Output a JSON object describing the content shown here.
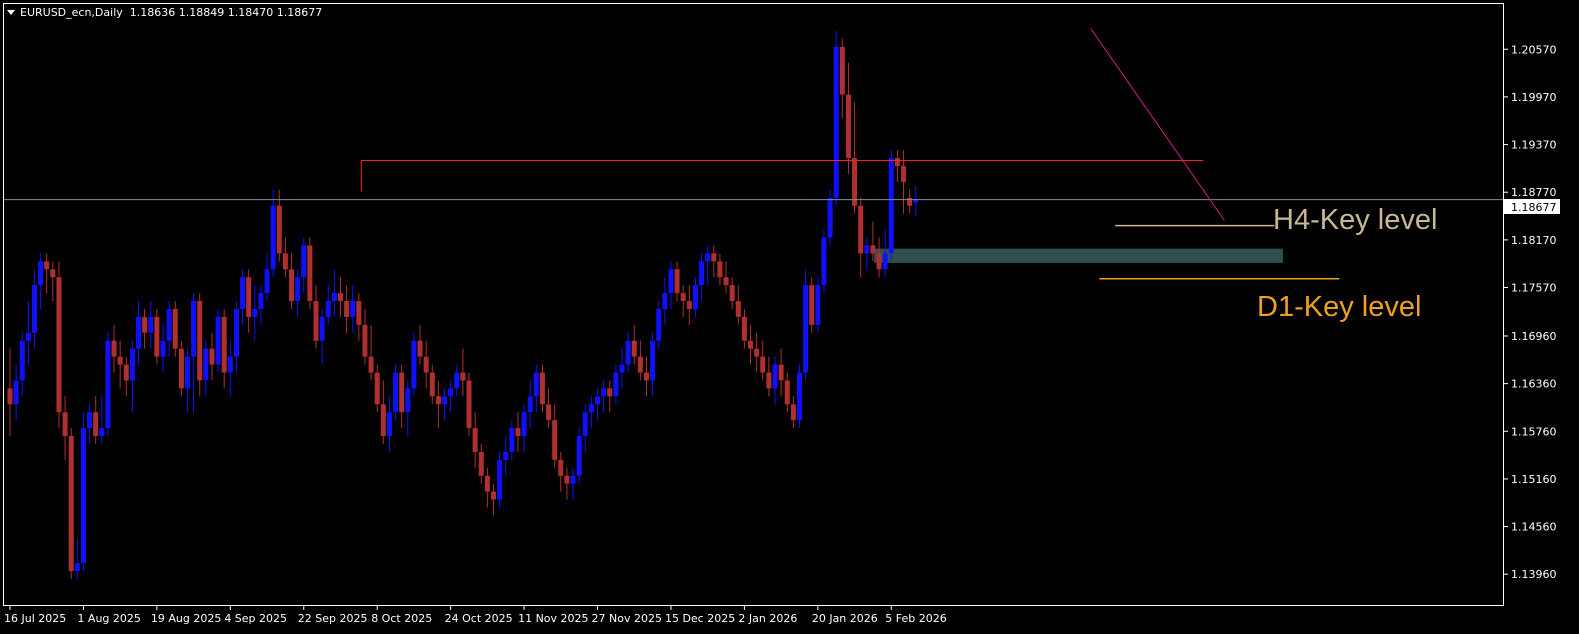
{
  "header": {
    "symbol": "EURUSD_ecn,Daily",
    "ohlc": "1.18636 1.18849 1.18470 1.18677"
  },
  "colors": {
    "background": "#000000",
    "frame": "#ffffff",
    "bull": "#1010ff",
    "bear": "#b03030",
    "bid_line": "#7f8fa6",
    "resistance_line": "#ff2020",
    "trend_line": "#d0208a",
    "h4_level": "#c8b994",
    "d1_level": "#f0a020",
    "zone": "#2f4f4f"
  },
  "chart_data": {
    "type": "candlestick",
    "xlabels": [
      "16 Jul 2025",
      "1 Aug 2025",
      "19 Aug 2025",
      "4 Sep 2025",
      "22 Sep 2025",
      "8 Oct 2025",
      "24 Oct 2025",
      "11 Nov 2025",
      "27 Nov 2025",
      "15 Dec 2025",
      "2 Jan 2026",
      "20 Jan 2026",
      "5 Feb 2026"
    ],
    "yticks": [
      "1.20570",
      "1.19970",
      "1.19370",
      "1.18770",
      "1.18170",
      "1.17570",
      "1.16960",
      "1.16360",
      "1.15760",
      "1.15160",
      "1.14560",
      "1.13960"
    ],
    "ylim": [
      1.1356,
      1.2114
    ],
    "current_price": "1.18677",
    "candles": [
      [
        1.163,
        1.168,
        1.157,
        1.161
      ],
      [
        1.161,
        1.166,
        1.159,
        1.164
      ],
      [
        1.164,
        1.17,
        1.162,
        1.169
      ],
      [
        1.169,
        1.174,
        1.166,
        1.17
      ],
      [
        1.17,
        1.178,
        1.168,
        1.176
      ],
      [
        1.176,
        1.18,
        1.173,
        1.179
      ],
      [
        1.179,
        1.18,
        1.175,
        1.178
      ],
      [
        1.178,
        1.179,
        1.174,
        1.177
      ],
      [
        1.177,
        1.179,
        1.158,
        1.16
      ],
      [
        1.16,
        1.162,
        1.154,
        1.157
      ],
      [
        1.157,
        1.158,
        1.139,
        1.14
      ],
      [
        1.14,
        1.144,
        1.139,
        1.141
      ],
      [
        1.141,
        1.16,
        1.14,
        1.158
      ],
      [
        1.158,
        1.161,
        1.156,
        1.16
      ],
      [
        1.16,
        1.162,
        1.156,
        1.157
      ],
      [
        1.157,
        1.162,
        1.156,
        1.158
      ],
      [
        1.158,
        1.17,
        1.157,
        1.169
      ],
      [
        1.169,
        1.171,
        1.165,
        1.167
      ],
      [
        1.167,
        1.169,
        1.163,
        1.166
      ],
      [
        1.166,
        1.167,
        1.162,
        1.164
      ],
      [
        1.164,
        1.169,
        1.16,
        1.168
      ],
      [
        1.168,
        1.174,
        1.166,
        1.172
      ],
      [
        1.172,
        1.173,
        1.168,
        1.17
      ],
      [
        1.17,
        1.174,
        1.168,
        1.172
      ],
      [
        1.172,
        1.173,
        1.166,
        1.167
      ],
      [
        1.167,
        1.171,
        1.165,
        1.169
      ],
      [
        1.169,
        1.174,
        1.167,
        1.173
      ],
      [
        1.173,
        1.174,
        1.167,
        1.168
      ],
      [
        1.168,
        1.169,
        1.162,
        1.163
      ],
      [
        1.163,
        1.168,
        1.16,
        1.167
      ],
      [
        1.167,
        1.175,
        1.16,
        1.174
      ],
      [
        1.174,
        1.175,
        1.162,
        1.164
      ],
      [
        1.164,
        1.169,
        1.162,
        1.168
      ],
      [
        1.168,
        1.17,
        1.164,
        1.166
      ],
      [
        1.166,
        1.173,
        1.165,
        1.172
      ],
      [
        1.172,
        1.173,
        1.163,
        1.165
      ],
      [
        1.165,
        1.169,
        1.162,
        1.167
      ],
      [
        1.167,
        1.174,
        1.165,
        1.173
      ],
      [
        1.173,
        1.178,
        1.171,
        1.177
      ],
      [
        1.177,
        1.178,
        1.17,
        1.172
      ],
      [
        1.172,
        1.176,
        1.169,
        1.173
      ],
      [
        1.173,
        1.176,
        1.171,
        1.175
      ],
      [
        1.175,
        1.18,
        1.174,
        1.178
      ],
      [
        1.178,
        1.188,
        1.177,
        1.186
      ],
      [
        1.186,
        1.188,
        1.179,
        1.18
      ],
      [
        1.18,
        1.182,
        1.177,
        1.178
      ],
      [
        1.178,
        1.18,
        1.173,
        1.174
      ],
      [
        1.174,
        1.178,
        1.172,
        1.177
      ],
      [
        1.177,
        1.182,
        1.175,
        1.181
      ],
      [
        1.181,
        1.182,
        1.173,
        1.174
      ],
      [
        1.174,
        1.176,
        1.168,
        1.169
      ],
      [
        1.169,
        1.173,
        1.166,
        1.172
      ],
      [
        1.172,
        1.176,
        1.171,
        1.174
      ],
      [
        1.174,
        1.178,
        1.172,
        1.175
      ],
      [
        1.175,
        1.177,
        1.172,
        1.174
      ],
      [
        1.174,
        1.176,
        1.17,
        1.172
      ],
      [
        1.172,
        1.176,
        1.17,
        1.174
      ],
      [
        1.174,
        1.175,
        1.169,
        1.171
      ],
      [
        1.171,
        1.173,
        1.166,
        1.167
      ],
      [
        1.167,
        1.171,
        1.164,
        1.165
      ],
      [
        1.165,
        1.166,
        1.16,
        1.161
      ],
      [
        1.161,
        1.164,
        1.156,
        1.157
      ],
      [
        1.157,
        1.162,
        1.155,
        1.16
      ],
      [
        1.16,
        1.166,
        1.159,
        1.165
      ],
      [
        1.165,
        1.166,
        1.158,
        1.16
      ],
      [
        1.16,
        1.164,
        1.157,
        1.163
      ],
      [
        1.163,
        1.17,
        1.162,
        1.169
      ],
      [
        1.169,
        1.171,
        1.166,
        1.167
      ],
      [
        1.167,
        1.169,
        1.163,
        1.165
      ],
      [
        1.165,
        1.166,
        1.161,
        1.162
      ],
      [
        1.162,
        1.164,
        1.158,
        1.161
      ],
      [
        1.161,
        1.163,
        1.159,
        1.162
      ],
      [
        1.162,
        1.164,
        1.16,
        1.163
      ],
      [
        1.163,
        1.166,
        1.162,
        1.165
      ],
      [
        1.165,
        1.168,
        1.162,
        1.164
      ],
      [
        1.164,
        1.165,
        1.157,
        1.158
      ],
      [
        1.158,
        1.16,
        1.153,
        1.155
      ],
      [
        1.155,
        1.156,
        1.151,
        1.152
      ],
      [
        1.152,
        1.153,
        1.148,
        1.15
      ],
      [
        1.15,
        1.151,
        1.147,
        1.149
      ],
      [
        1.149,
        1.155,
        1.148,
        1.154
      ],
      [
        1.154,
        1.157,
        1.152,
        1.155
      ],
      [
        1.155,
        1.159,
        1.154,
        1.158
      ],
      [
        1.158,
        1.16,
        1.155,
        1.157
      ],
      [
        1.157,
        1.161,
        1.155,
        1.16
      ],
      [
        1.16,
        1.164,
        1.158,
        1.162
      ],
      [
        1.162,
        1.166,
        1.16,
        1.165
      ],
      [
        1.165,
        1.166,
        1.16,
        1.161
      ],
      [
        1.161,
        1.163,
        1.158,
        1.159
      ],
      [
        1.159,
        1.161,
        1.153,
        1.154
      ],
      [
        1.154,
        1.155,
        1.15,
        1.152
      ],
      [
        1.152,
        1.153,
        1.149,
        1.151
      ],
      [
        1.151,
        1.153,
        1.149,
        1.152
      ],
      [
        1.152,
        1.158,
        1.151,
        1.157
      ],
      [
        1.157,
        1.161,
        1.155,
        1.16
      ],
      [
        1.16,
        1.162,
        1.158,
        1.161
      ],
      [
        1.161,
        1.163,
        1.159,
        1.162
      ],
      [
        1.162,
        1.164,
        1.16,
        1.163
      ],
      [
        1.163,
        1.164,
        1.16,
        1.162
      ],
      [
        1.162,
        1.166,
        1.161,
        1.165
      ],
      [
        1.165,
        1.168,
        1.163,
        1.166
      ],
      [
        1.166,
        1.17,
        1.165,
        1.169
      ],
      [
        1.169,
        1.171,
        1.166,
        1.167
      ],
      [
        1.167,
        1.169,
        1.164,
        1.165
      ],
      [
        1.165,
        1.167,
        1.162,
        1.164
      ],
      [
        1.164,
        1.17,
        1.162,
        1.169
      ],
      [
        1.169,
        1.174,
        1.168,
        1.173
      ],
      [
        1.173,
        1.177,
        1.171,
        1.175
      ],
      [
        1.175,
        1.179,
        1.173,
        1.178
      ],
      [
        1.178,
        1.179,
        1.174,
        1.175
      ],
      [
        1.175,
        1.176,
        1.172,
        1.174
      ],
      [
        1.174,
        1.176,
        1.171,
        1.173
      ],
      [
        1.173,
        1.177,
        1.172,
        1.176
      ],
      [
        1.176,
        1.18,
        1.174,
        1.179
      ],
      [
        1.179,
        1.181,
        1.176,
        1.18
      ],
      [
        1.18,
        1.181,
        1.177,
        1.179
      ],
      [
        1.179,
        1.18,
        1.176,
        1.177
      ],
      [
        1.177,
        1.179,
        1.175,
        1.176
      ],
      [
        1.176,
        1.177,
        1.173,
        1.174
      ],
      [
        1.174,
        1.176,
        1.171,
        1.172
      ],
      [
        1.172,
        1.173,
        1.168,
        1.169
      ],
      [
        1.169,
        1.171,
        1.166,
        1.168
      ],
      [
        1.168,
        1.17,
        1.165,
        1.167
      ],
      [
        1.167,
        1.169,
        1.164,
        1.165
      ],
      [
        1.165,
        1.167,
        1.162,
        1.163
      ],
      [
        1.163,
        1.167,
        1.161,
        1.166
      ],
      [
        1.166,
        1.168,
        1.162,
        1.164
      ],
      [
        1.164,
        1.165,
        1.16,
        1.161
      ],
      [
        1.161,
        1.162,
        1.158,
        1.159
      ],
      [
        1.159,
        1.166,
        1.158,
        1.165
      ],
      [
        1.165,
        1.178,
        1.164,
        1.176
      ],
      [
        1.176,
        1.177,
        1.17,
        1.171
      ],
      [
        1.171,
        1.177,
        1.17,
        1.176
      ],
      [
        1.176,
        1.183,
        1.175,
        1.182
      ],
      [
        1.182,
        1.188,
        1.181,
        1.187
      ],
      [
        1.187,
        1.208,
        1.186,
        1.206
      ],
      [
        1.206,
        1.207,
        1.197,
        1.2
      ],
      [
        1.2,
        1.204,
        1.19,
        1.192
      ],
      [
        1.192,
        1.199,
        1.185,
        1.186
      ],
      [
        1.186,
        1.187,
        1.177,
        1.18
      ],
      [
        1.18,
        1.182,
        1.178,
        1.181
      ],
      [
        1.181,
        1.184,
        1.179,
        1.18
      ],
      [
        1.18,
        1.182,
        1.177,
        1.178
      ],
      [
        1.178,
        1.183,
        1.177,
        1.18
      ],
      [
        1.18,
        1.193,
        1.179,
        1.192
      ],
      [
        1.192,
        1.193,
        1.189,
        1.191
      ],
      [
        1.191,
        1.193,
        1.185,
        1.189
      ],
      [
        1.187,
        1.188,
        1.185,
        1.186
      ],
      [
        1.1864,
        1.1885,
        1.1847,
        1.1868
      ]
    ]
  },
  "annotations": {
    "h4_label": "H4-Key level",
    "d1_label": "D1-Key level"
  }
}
